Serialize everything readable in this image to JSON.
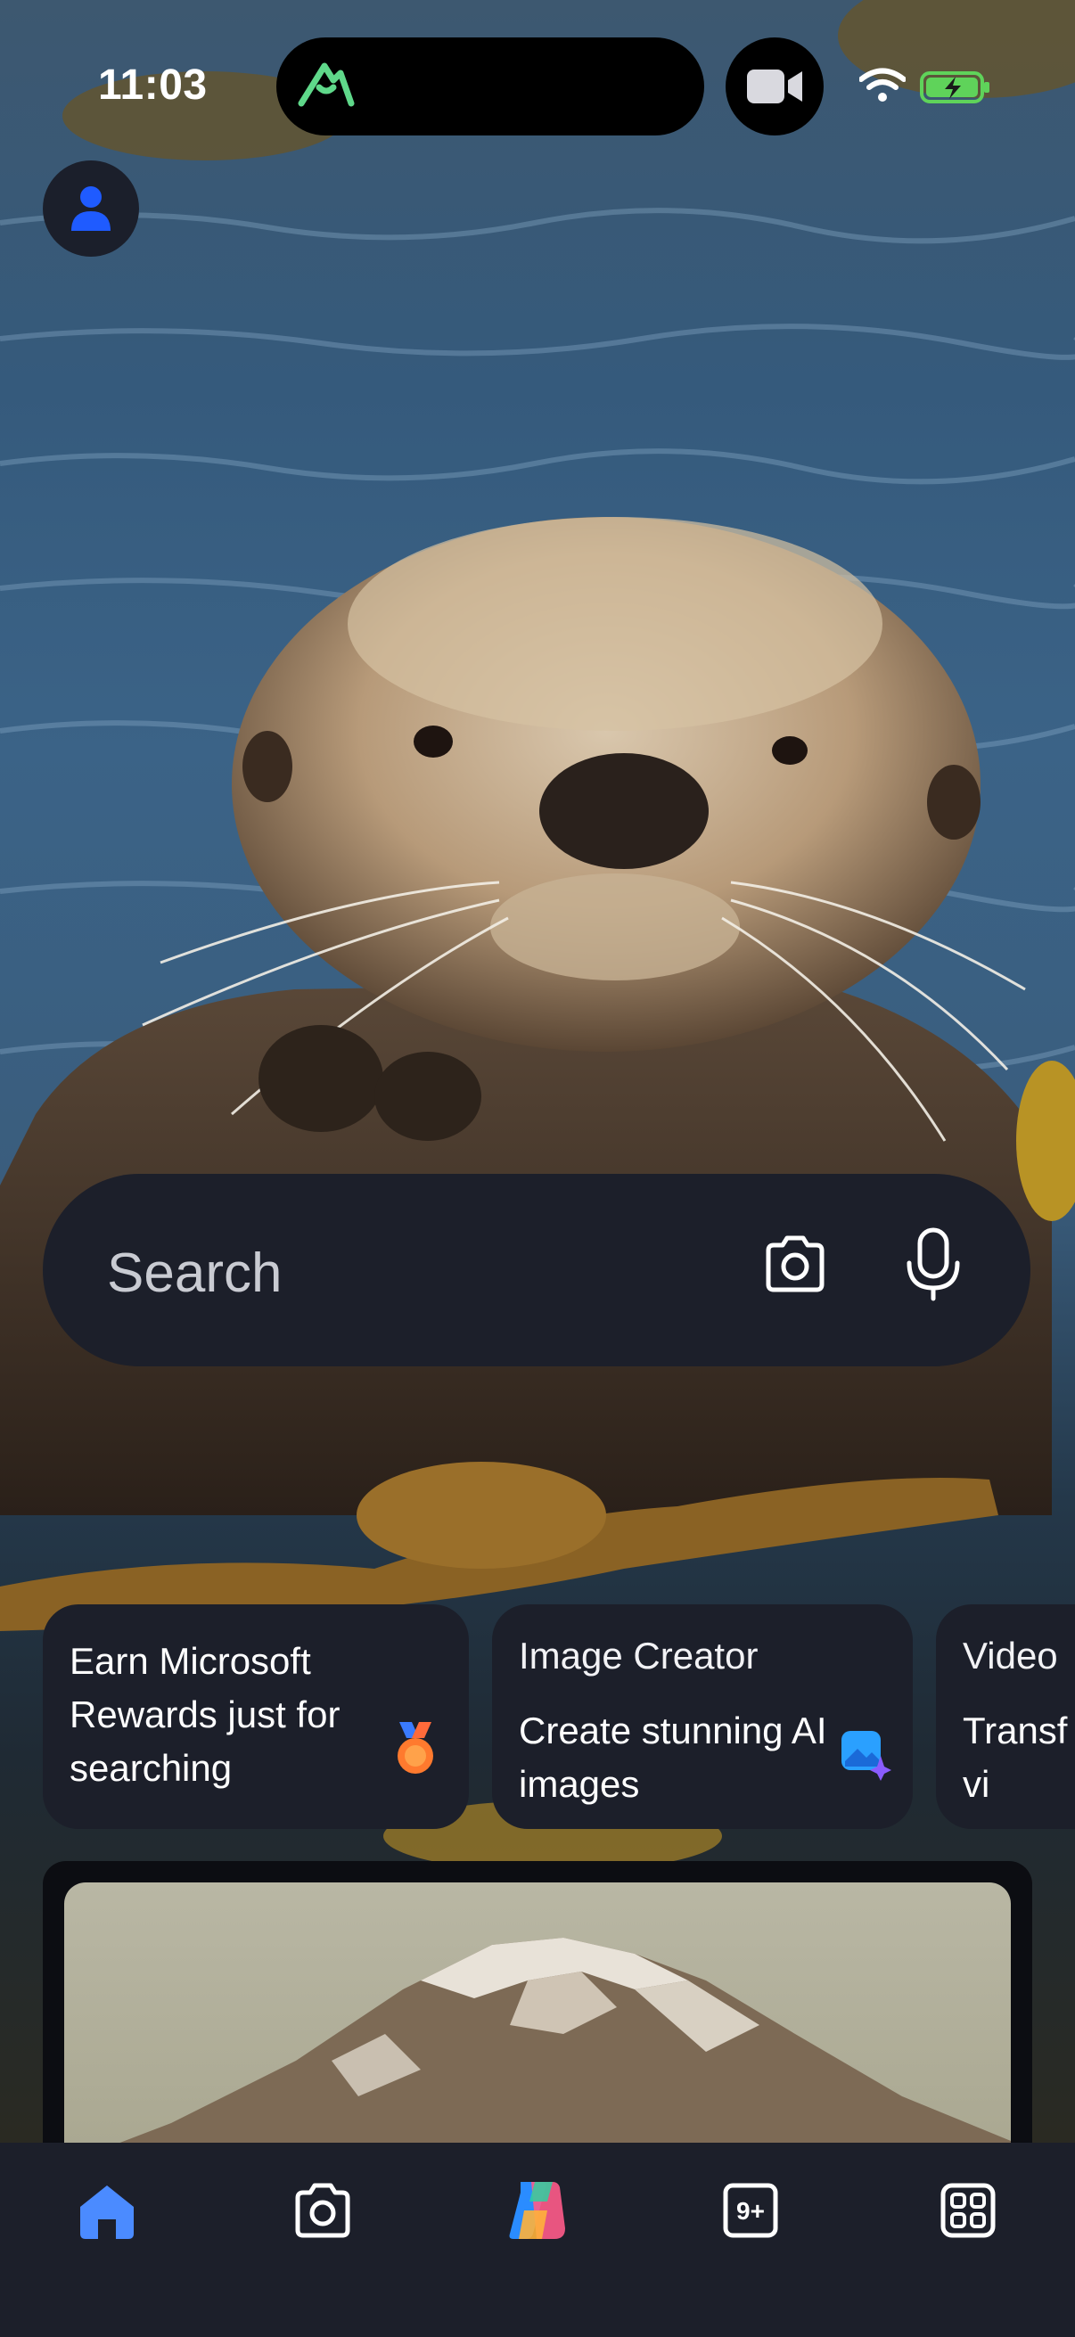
{
  "status_bar": {
    "time": "11:03",
    "battery_state": "charging",
    "wifi": "connected"
  },
  "colors": {
    "accent_blue": "#4b8bff",
    "surface": "#1c1f2a",
    "battery_green": "#5fd35a",
    "island_icon_green": "#5fd88a"
  },
  "search": {
    "placeholder": "Search",
    "camera_icon": "camera-icon",
    "mic_icon": "microphone-icon"
  },
  "cards": [
    {
      "text": "Earn Microsoft Rewards just for searching",
      "icon": "medal-icon"
    },
    {
      "title": "Image Creator",
      "body": "Create stunning AI images",
      "icon": "image-creator-icon"
    },
    {
      "title": "Video",
      "body": "Transf into vi"
    }
  ],
  "bottom_nav": {
    "items": [
      {
        "name": "home",
        "icon": "home-icon",
        "active": true
      },
      {
        "name": "camera",
        "icon": "camera-icon"
      },
      {
        "name": "copilot",
        "icon": "copilot-icon"
      },
      {
        "name": "tabs",
        "icon": "tabs-icon",
        "count": "9+"
      },
      {
        "name": "apps",
        "icon": "apps-grid-icon"
      }
    ]
  }
}
